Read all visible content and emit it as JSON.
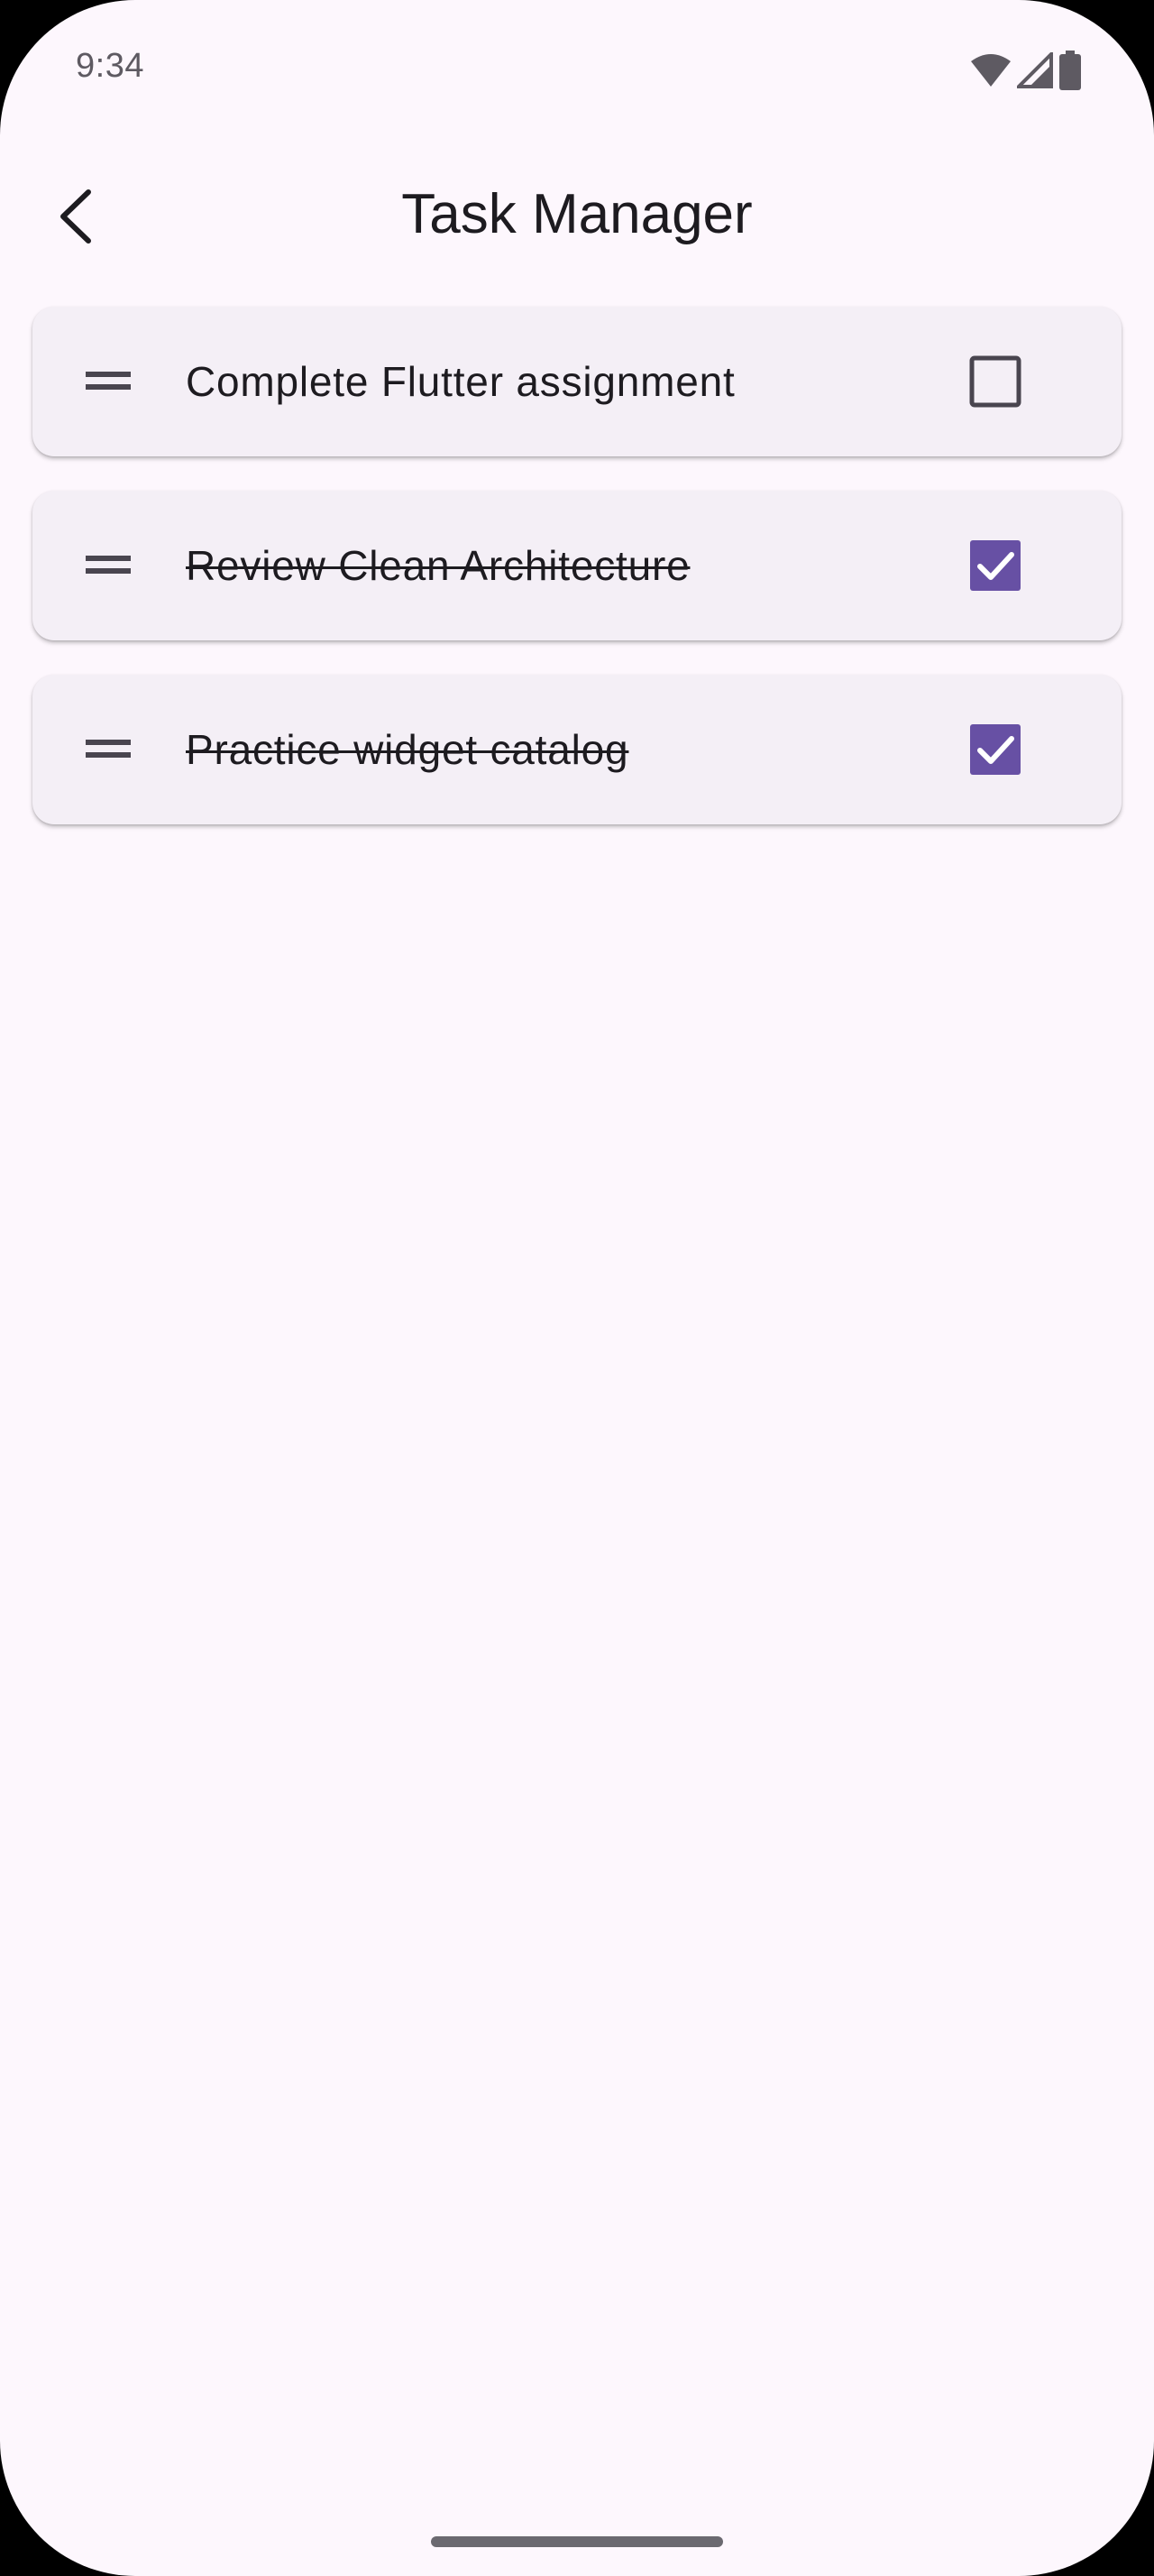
{
  "status_bar": {
    "time": "9:34",
    "icons": [
      "wifi-icon",
      "cellular-signal-icon",
      "battery-icon"
    ]
  },
  "app_bar": {
    "title": "Task Manager",
    "back_icon": "back-arrow-icon"
  },
  "tasks": [
    {
      "title": "Complete Flutter assignment",
      "completed": false
    },
    {
      "title": "Review Clean Architecture",
      "completed": true
    },
    {
      "title": "Practice widget catalog",
      "completed": true
    }
  ],
  "colors": {
    "background": "#fdf7fd",
    "card": "#f4eff6",
    "accent": "#6750a4",
    "text": "#1d1b20",
    "icon": "#49454f"
  }
}
